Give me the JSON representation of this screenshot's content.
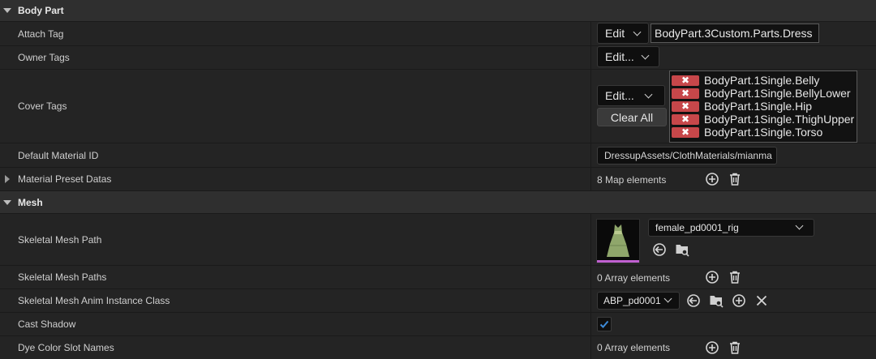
{
  "sections": {
    "body_part": "Body Part",
    "mesh": "Mesh"
  },
  "body_part": {
    "attach_tag": {
      "label": "Attach Tag",
      "button": "Edit",
      "value": "BodyPart.3Custom.Parts.Dress"
    },
    "owner_tags": {
      "label": "Owner Tags",
      "button": "Edit..."
    },
    "cover_tags": {
      "label": "Cover Tags",
      "button": "Edit...",
      "clear_all": "Clear All",
      "tags": [
        "BodyPart.1Single.Belly",
        "BodyPart.1Single.BellyLower",
        "BodyPart.1Single.Hip",
        "BodyPart.1Single.ThighUpper",
        "BodyPart.1Single.Torso"
      ]
    },
    "default_material_id": {
      "label": "Default Material ID",
      "value": "DressupAssets/ClothMaterials/mianma"
    },
    "material_preset_datas": {
      "label": "Material Preset Datas",
      "value": "8 Map elements"
    }
  },
  "mesh": {
    "skeletal_mesh_path": {
      "label": "Skeletal Mesh Path",
      "value": "female_pd0001_rig"
    },
    "skeletal_mesh_paths": {
      "label": "Skeletal Mesh Paths",
      "value": "0 Array elements"
    },
    "anim_instance_class": {
      "label": "Skeletal Mesh Anim Instance Class",
      "value": "ABP_pd0001"
    },
    "cast_shadow": {
      "label": "Cast Shadow",
      "checked": true
    },
    "dye_color_slot_names": {
      "label": "Dye Color Slot Names",
      "value": "0 Array elements"
    }
  },
  "colors": {
    "tag_remove": "#c7474a",
    "checkbox_check": "#3d8bd8",
    "thumbnail_underline": "#c060d0"
  }
}
